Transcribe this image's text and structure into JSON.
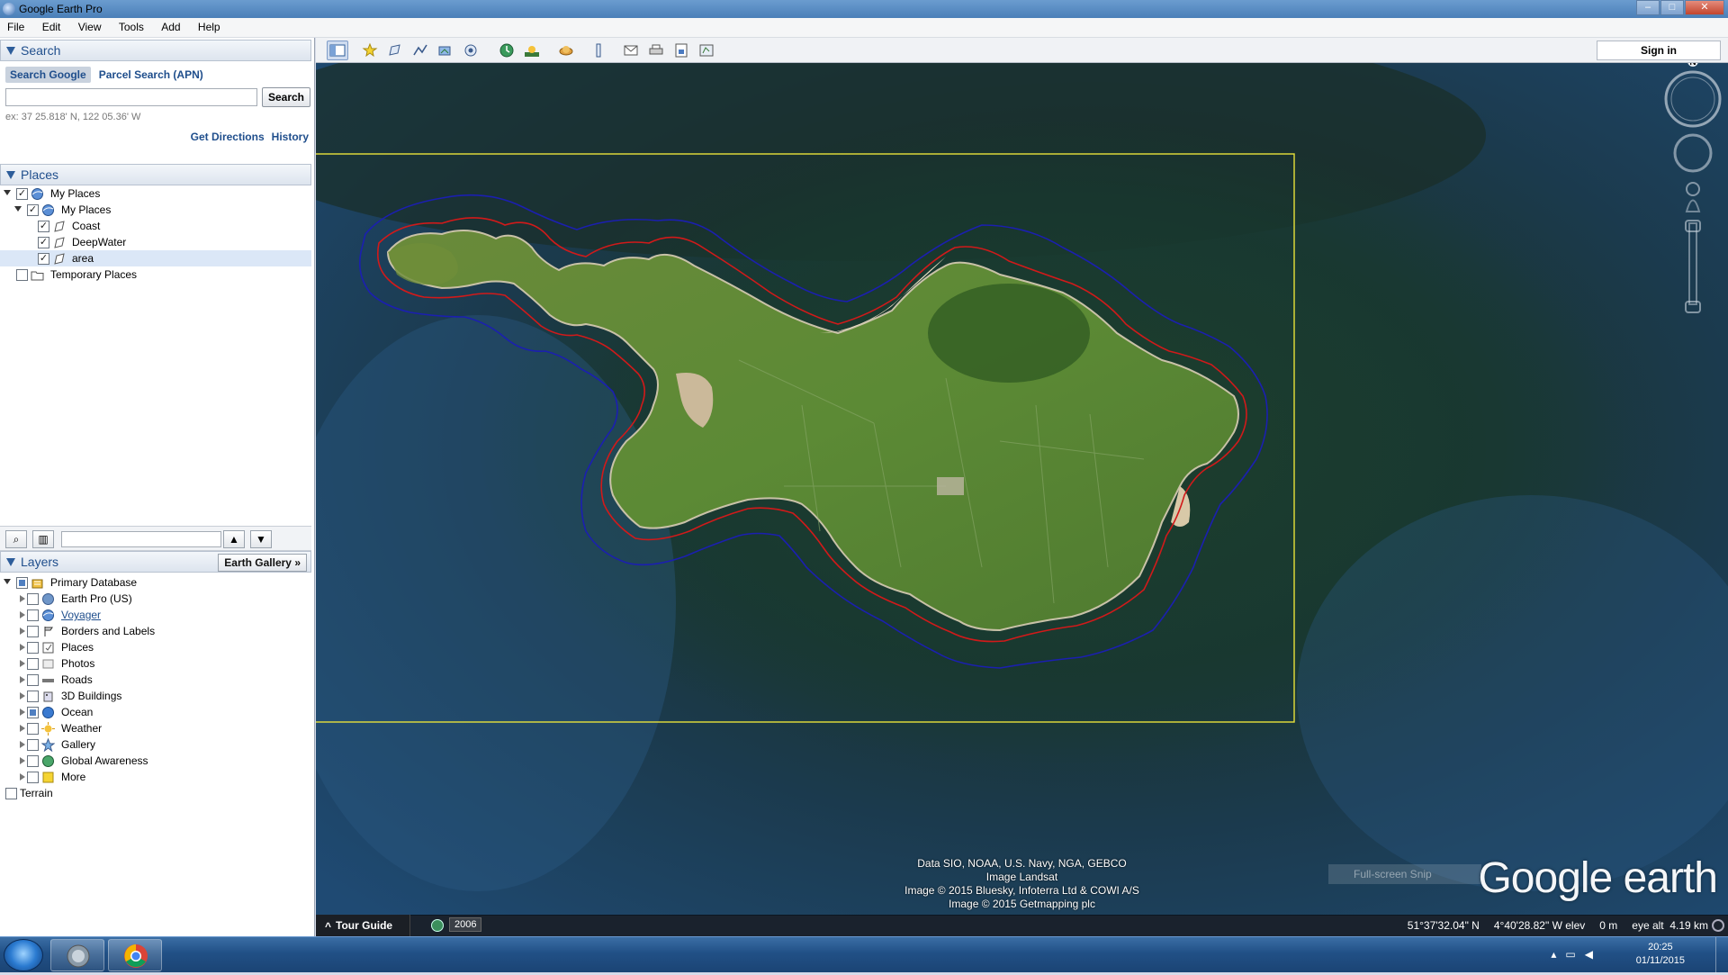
{
  "window": {
    "title": "Google Earth Pro"
  },
  "menu": [
    "File",
    "Edit",
    "View",
    "Tools",
    "Add",
    "Help"
  ],
  "search": {
    "header": "Search",
    "tabs": [
      "Search Google",
      "Parcel Search (APN)"
    ],
    "button": "Search",
    "hint": "ex: 37 25.818' N, 122 05.36' W",
    "links": [
      "Get Directions",
      "History"
    ]
  },
  "places": {
    "header": "Places",
    "items": [
      {
        "label": "My Places",
        "level": 0,
        "checked": true
      },
      {
        "label": "My Places",
        "level": 1,
        "checked": true
      },
      {
        "label": "Coast",
        "level": 2,
        "checked": true
      },
      {
        "label": "DeepWater",
        "level": 2,
        "checked": true
      },
      {
        "label": "area",
        "level": 2,
        "checked": true,
        "selected": true
      },
      {
        "label": "Temporary Places",
        "level": 0,
        "checked": false
      }
    ]
  },
  "layers": {
    "header": "Layers",
    "gallery_button": "Earth Gallery",
    "items": [
      {
        "label": "Primary Database",
        "icon": "database-icon",
        "state": "partial"
      },
      {
        "label": "Earth Pro (US)",
        "icon": "earth-icon",
        "state": "unchecked"
      },
      {
        "label": "Voyager",
        "icon": "voyager-icon",
        "state": "unchecked",
        "link": true
      },
      {
        "label": "Borders and Labels",
        "icon": "borders-icon",
        "state": "unchecked"
      },
      {
        "label": "Places",
        "icon": "places-icon",
        "state": "unchecked"
      },
      {
        "label": "Photos",
        "icon": "photos-icon",
        "state": "unchecked"
      },
      {
        "label": "Roads",
        "icon": "roads-icon",
        "state": "unchecked"
      },
      {
        "label": "3D Buildings",
        "icon": "buildings-icon",
        "state": "unchecked"
      },
      {
        "label": "Ocean",
        "icon": "ocean-icon",
        "state": "partial"
      },
      {
        "label": "Weather",
        "icon": "weather-icon",
        "state": "unchecked"
      },
      {
        "label": "Gallery",
        "icon": "gallery-icon",
        "state": "unchecked"
      },
      {
        "label": "Global Awareness",
        "icon": "globe-icon",
        "state": "unchecked"
      },
      {
        "label": "More",
        "icon": "more-icon",
        "state": "unchecked"
      },
      {
        "label": "Terrain",
        "icon": "",
        "state": "unchecked"
      }
    ]
  },
  "toolbar": {
    "sign_in": "Sign in"
  },
  "map": {
    "attribution": [
      "Data SIO, NOAA, U.S. Navy, NGA, GEBCO",
      "Image Landsat",
      "Image © 2015 Bluesky, Infoterra Ltd & COWI A/S",
      "Image © 2015 Getmapping plc"
    ],
    "logo": {
      "brand": "Google",
      "product": "earth"
    },
    "snip_label": "Full-screen Snip",
    "compass_label": "N"
  },
  "status": {
    "tour_guide": "Tour Guide",
    "year": "2006",
    "latitude": "51°37'32.04\" N",
    "longitude": "4°40'28.82\" W",
    "elev_label": "elev",
    "elev_value": "0 m",
    "eye_alt_label": "eye alt",
    "eye_alt_value": "4.19 km"
  },
  "taskbar": {
    "time": "20:25",
    "date": "01/11/2015"
  },
  "colors": {
    "coast_line": "#d11a1a",
    "deepwater_line": "#1b1fb0",
    "area_box": "#e8e23a"
  }
}
